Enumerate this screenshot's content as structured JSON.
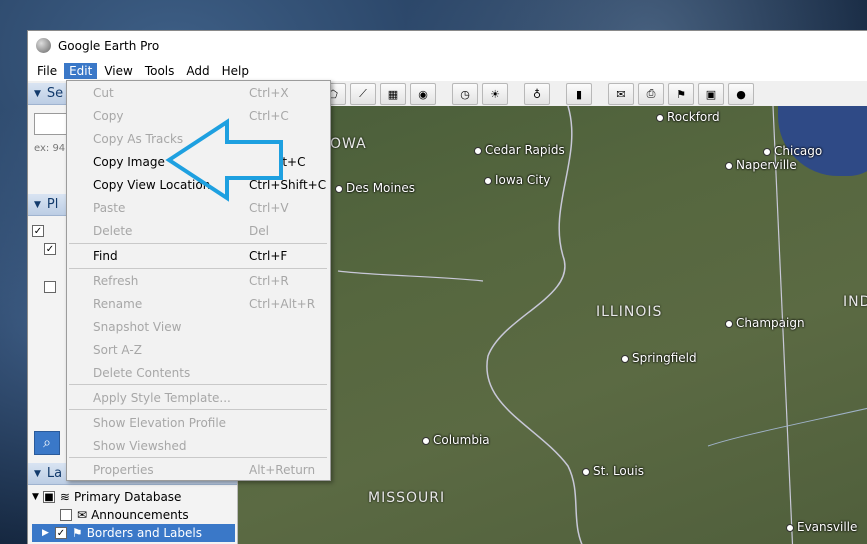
{
  "window": {
    "title": "Google Earth Pro"
  },
  "menubar": [
    {
      "label": "File"
    },
    {
      "label": "Edit"
    },
    {
      "label": "View"
    },
    {
      "label": "Tools"
    },
    {
      "label": "Add"
    },
    {
      "label": "Help"
    }
  ],
  "sidebar": {
    "search_header": "Se",
    "search_hint": "ex: 94",
    "places_header": "Pl",
    "layers_header": "La",
    "layers": [
      {
        "label": "Primary Database"
      },
      {
        "label": "Announcements"
      },
      {
        "label": "Borders and Labels"
      }
    ]
  },
  "edit_menu": {
    "items": [
      {
        "label": "Cut",
        "shortcut": "Ctrl+X"
      },
      {
        "label": "Copy",
        "shortcut": "Ctrl+C"
      },
      {
        "label": "Copy As Tracks",
        "shortcut": ""
      },
      {
        "label": "Copy Image",
        "shortcut": "lt+C"
      },
      {
        "label": "Copy View Location",
        "shortcut": "Ctrl+Shift+C"
      },
      {
        "label": "Paste",
        "shortcut": "Ctrl+V"
      },
      {
        "label": "Delete",
        "shortcut": "Del"
      },
      {
        "label": "Find",
        "shortcut": "Ctrl+F"
      },
      {
        "label": "Refresh",
        "shortcut": "Ctrl+R"
      },
      {
        "label": "Rename",
        "shortcut": "Ctrl+Alt+R"
      },
      {
        "label": "Snapshot View",
        "shortcut": ""
      },
      {
        "label": "Sort A-Z",
        "shortcut": ""
      },
      {
        "label": "Delete Contents",
        "shortcut": ""
      },
      {
        "label": "Apply Style Template...",
        "shortcut": ""
      },
      {
        "label": "Show Elevation Profile",
        "shortcut": ""
      },
      {
        "label": "Show Viewshed",
        "shortcut": ""
      },
      {
        "label": "Properties",
        "shortcut": "Alt+Return"
      }
    ]
  },
  "map": {
    "cities": [
      {
        "name": "Rockford"
      },
      {
        "name": "Chicago"
      },
      {
        "name": "Naperville"
      },
      {
        "name": "Cedar Rapids"
      },
      {
        "name": "Iowa City"
      },
      {
        "name": "Des Moines"
      },
      {
        "name": "Champaign"
      },
      {
        "name": "Springfield"
      },
      {
        "name": "Columbia"
      },
      {
        "name": "St. Louis"
      },
      {
        "name": "Evansville"
      }
    ],
    "states": [
      {
        "name": "OWA"
      },
      {
        "name": "ILLINOIS"
      },
      {
        "name": "MISSOURI"
      },
      {
        "name": "IND"
      }
    ]
  },
  "colors": {
    "menu_highlight": "#3a78c8",
    "arrow": "#1ea0e0"
  }
}
